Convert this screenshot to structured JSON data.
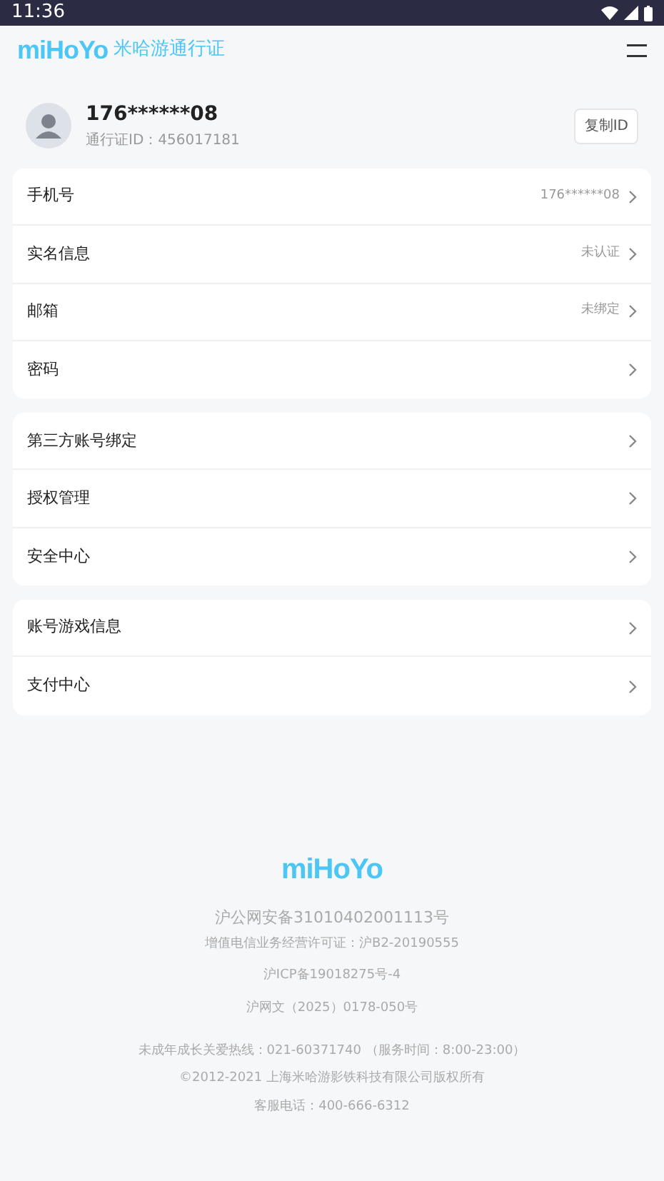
{
  "status_bar": {
    "time": "11:36"
  },
  "header": {
    "logo": "miHoYo",
    "title": "米哈游通行证"
  },
  "profile": {
    "name": "176******08",
    "pass_id": "通行证ID：456017181",
    "copy_button": "复制ID"
  },
  "groups": [
    {
      "items": [
        {
          "label": "手机号",
          "value": "176******08"
        },
        {
          "label": "实名信息",
          "value": "未认证"
        },
        {
          "label": "邮箱",
          "value": "未绑定"
        },
        {
          "label": "密码"
        }
      ]
    },
    {
      "items": [
        {
          "label": "第三方账号绑定"
        },
        {
          "label": "授权管理"
        },
        {
          "label": "安全中心"
        }
      ]
    },
    {
      "items": [
        {
          "label": "账号游戏信息"
        },
        {
          "label": "支付中心"
        }
      ]
    }
  ],
  "footer": {
    "logo": "miHoYo",
    "lines": [
      "沪公网安备31010402001113号",
      "增值电信业务经营许可证：沪B2-20190555",
      "沪ICP备19018275号-4",
      "沪网文（2025）0178-050号",
      "未成年成长关爱热线：021-60371740 （服务时间：8:00-23:00）",
      "©2012-2021 上海米哈游影铁科技有限公司版权所有",
      "客服电话：400-666-6312"
    ]
  }
}
